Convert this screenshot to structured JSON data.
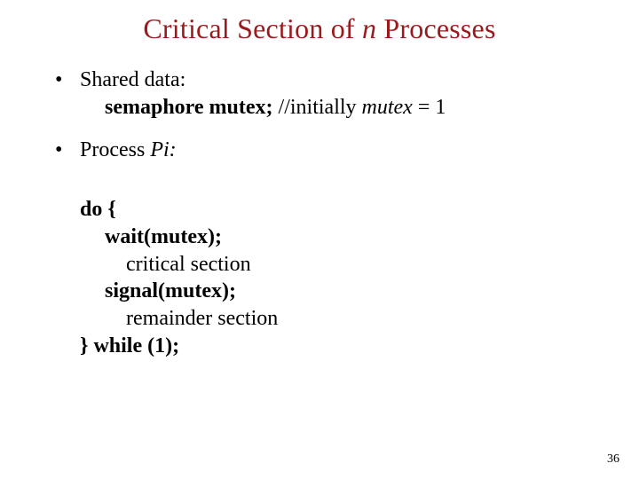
{
  "title": {
    "prefix": "Critical Section of ",
    "n": "n",
    "suffix": " Processes"
  },
  "bullet_marker": "•",
  "bullets": {
    "b1": "Shared data:",
    "b1_line2_a": "semaphore mutex;",
    "b1_line2_b": " //initially ",
    "b1_line2_c": "mutex",
    "b1_line2_d": " = 1",
    "b2_a": "Process ",
    "b2_b": "Pi:"
  },
  "code": {
    "l1": "do {",
    "l2": "wait(mutex);",
    "l3": "critical section",
    "l4": "signal(mutex);",
    "l5": "remainder section",
    "l6": "} while (1);"
  },
  "page_number": "36"
}
